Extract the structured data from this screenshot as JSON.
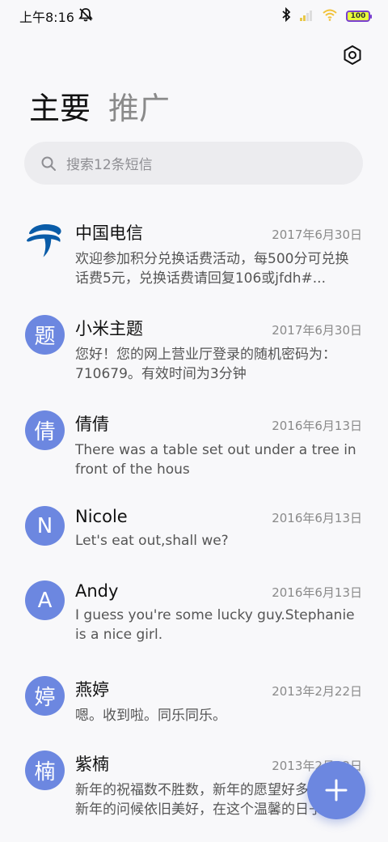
{
  "status_bar": {
    "time": "上午8:16",
    "battery": "100",
    "icons": [
      "mute-icon",
      "bluetooth-icon",
      "signal-icon",
      "wifi-icon",
      "battery-icon"
    ]
  },
  "header": {
    "tabs": [
      {
        "label": "主要",
        "active": true
      },
      {
        "label": "推广",
        "active": false
      }
    ],
    "settings_icon": "settings-hexagon-icon"
  },
  "search": {
    "placeholder": "搜索12条短信"
  },
  "conversations": [
    {
      "name": "中国电信",
      "date": "2017年6月30日",
      "preview": "欢迎参加积分兑换话费活动，每500分可兑换话费5元，兑换话费请回复106或jfdh#...",
      "avatar": "",
      "avatar_type": "logo"
    },
    {
      "name": "小米主题",
      "date": "2017年6月30日",
      "preview": "您好！您的网上营业厅登录的随机密码为：710679。有效时间为3分钟",
      "avatar": "题",
      "avatar_type": "letter"
    },
    {
      "name": "倩倩",
      "date": "2016年6月13日",
      "preview": "There was a table set out under a tree in front of the hous",
      "avatar": "倩",
      "avatar_type": "letter"
    },
    {
      "name": "Nicole",
      "date": "2016年6月13日",
      "preview": "Let's eat out,shall we?",
      "avatar": "N",
      "avatar_type": "letter"
    },
    {
      "name": "Andy",
      "date": "2016年6月13日",
      "preview": "I guess you're some lucky guy.Stephanie is a nice girl.",
      "avatar": "A",
      "avatar_type": "letter"
    },
    {
      "name": "燕婷",
      "date": "2013年2月22日",
      "preview": "嗯。收到啦。同乐同乐。",
      "avatar": "婷",
      "avatar_type": "letter"
    },
    {
      "name": "紫楠",
      "date": "2013年2月22日",
      "preview": "新年的祝福数不胜数，新年的愿望好多好多，新年的问候依旧美好，在这个温馨的日子里",
      "avatar": "楠",
      "avatar_type": "letter"
    }
  ],
  "fab": {
    "icon": "plus-icon"
  },
  "colors": {
    "accent": "#6c87e0",
    "background": "#f8f8fa",
    "telecom_blue": "#0a5ca8"
  }
}
